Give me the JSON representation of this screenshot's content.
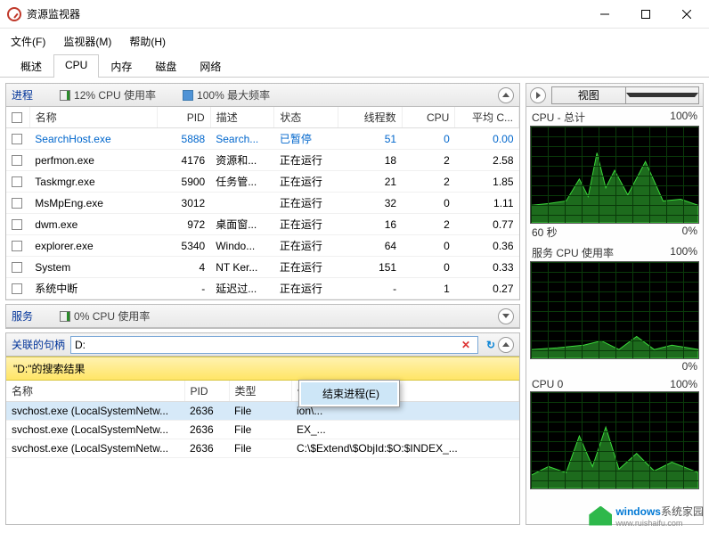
{
  "window": {
    "title": "资源监视器"
  },
  "menu": [
    "文件(F)",
    "监视器(M)",
    "帮助(H)"
  ],
  "tabs": {
    "items": [
      "概述",
      "CPU",
      "内存",
      "磁盘",
      "网络"
    ],
    "active": 1
  },
  "proc_panel": {
    "title": "进程",
    "stat1": "12% CPU 使用率",
    "stat2": "100% 最大频率",
    "cols": [
      "名称",
      "PID",
      "描述",
      "状态",
      "线程数",
      "CPU",
      "平均 C..."
    ]
  },
  "processes": [
    {
      "name": "SearchHost.exe",
      "pid": "5888",
      "desc": "Search...",
      "state": "已暂停",
      "th": "51",
      "cpu": "0",
      "avg": "0.00",
      "hl": true
    },
    {
      "name": "perfmon.exe",
      "pid": "4176",
      "desc": "资源和...",
      "state": "正在运行",
      "th": "18",
      "cpu": "2",
      "avg": "2.58"
    },
    {
      "name": "Taskmgr.exe",
      "pid": "5900",
      "desc": "任务管...",
      "state": "正在运行",
      "th": "21",
      "cpu": "2",
      "avg": "1.85"
    },
    {
      "name": "MsMpEng.exe",
      "pid": "3012",
      "desc": "",
      "state": "正在运行",
      "th": "32",
      "cpu": "0",
      "avg": "1.11"
    },
    {
      "name": "dwm.exe",
      "pid": "972",
      "desc": "桌面窗...",
      "state": "正在运行",
      "th": "16",
      "cpu": "2",
      "avg": "0.77"
    },
    {
      "name": "explorer.exe",
      "pid": "5340",
      "desc": "Windo...",
      "state": "正在运行",
      "th": "64",
      "cpu": "0",
      "avg": "0.36"
    },
    {
      "name": "System",
      "pid": "4",
      "desc": "NT Ker...",
      "state": "正在运行",
      "th": "151",
      "cpu": "0",
      "avg": "0.33"
    },
    {
      "name": "系统中断",
      "pid": "-",
      "desc": "延迟过...",
      "state": "正在运行",
      "th": "-",
      "cpu": "1",
      "avg": "0.27"
    }
  ],
  "svc_panel": {
    "title": "服务",
    "stat": "0% CPU 使用率"
  },
  "handle_panel": {
    "title": "关联的句柄",
    "filter": {
      "value": "D:",
      "placeholder": ""
    },
    "subhead": "\"D:\"的搜索结果",
    "cols": [
      "名称",
      "PID",
      "类型",
      "句柄名称"
    ]
  },
  "handles": [
    {
      "name": "svchost.exe (LocalSystemNetw...",
      "pid": "2636",
      "type": "File",
      "hn": "ion\\...",
      "sel": true
    },
    {
      "name": "svchost.exe (LocalSystemNetw...",
      "pid": "2636",
      "type": "File",
      "hn": "EX_..."
    },
    {
      "name": "svchost.exe (LocalSystemNetw...",
      "pid": "2636",
      "type": "File",
      "hn": "C:\\$Extend\\$ObjId:$O:$INDEX_..."
    }
  ],
  "context_menu": {
    "item": "结束进程(E)"
  },
  "right": {
    "view_label": "视图",
    "charts": [
      {
        "title": "CPU - 总计",
        "r": "100%",
        "bl": "60 秒",
        "br": "0%"
      },
      {
        "title": "服务 CPU 使用率",
        "r": "100%",
        "bl": "",
        "br": "0%"
      },
      {
        "title": "CPU 0",
        "r": "100%",
        "bl": "",
        "br": ""
      }
    ]
  },
  "watermark": {
    "b": "windows",
    "rest": "系统家园",
    "url": "www.ruishaifu.com"
  }
}
